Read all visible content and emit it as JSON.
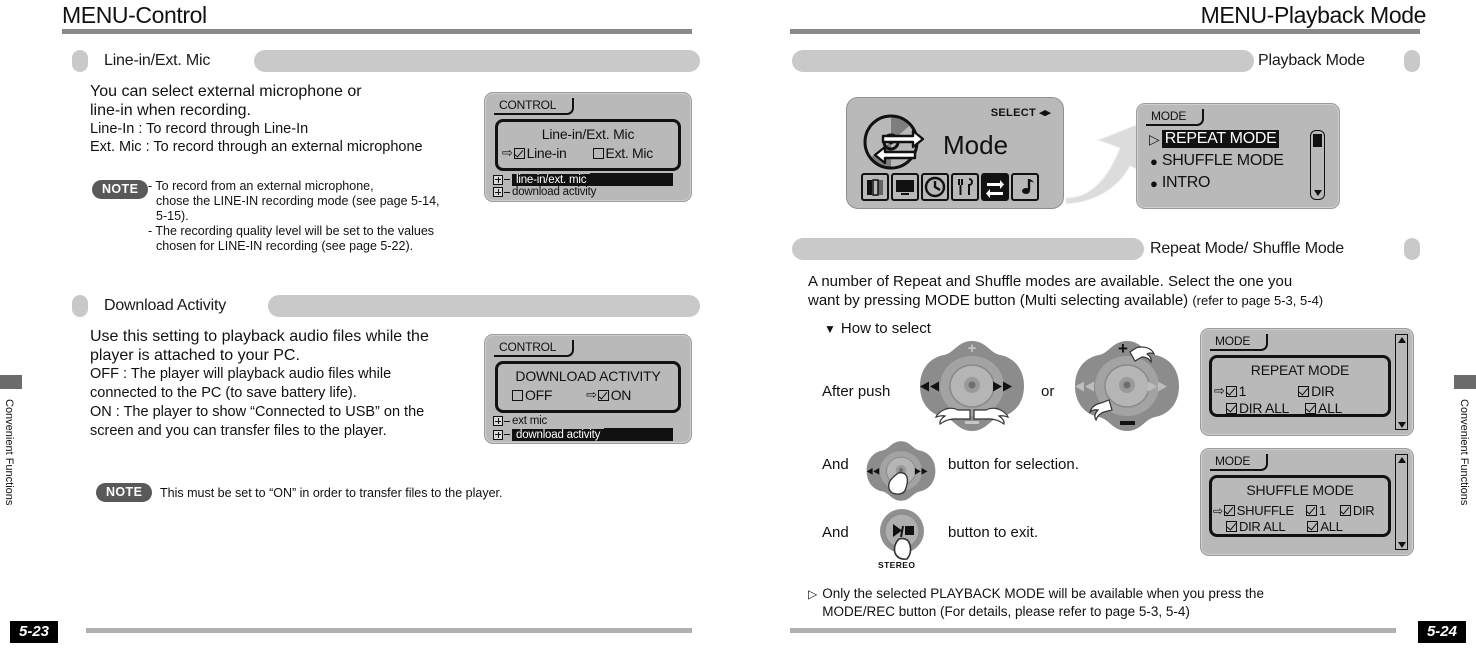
{
  "left_page": {
    "running_head": "MENU-Control",
    "side_tab_label": "Convenient Functions",
    "page_number": "5-23",
    "sections": [
      {
        "title": "Line-in/Ext. Mic",
        "paragraph_lines": [
          "You can select external microphone or",
          "line-in when recording.",
          "Line-In : To record through Line-In",
          "Ext. Mic : To record through an external microphone"
        ],
        "note": {
          "label": "NOTE",
          "lines": [
            "- To record from an external microphone,",
            "chose the LINE-IN recording mode (see page 5-14,",
            "5-15).",
            "- The recording quality level will be set to the values",
            "chosen for LINE-IN recording (see page 5-22)."
          ]
        },
        "lcd": {
          "tab": "CONTROL",
          "window_title": "Line-in/Ext. Mic",
          "options": [
            {
              "label": "Line-in",
              "checked": true,
              "cursor": true
            },
            {
              "label": "Ext. Mic",
              "checked": false,
              "cursor": false
            }
          ],
          "tree": [
            {
              "label": "line-in/ext. mic",
              "selected": true
            },
            {
              "label": "download activity",
              "selected": false
            }
          ]
        }
      },
      {
        "title": "Download Activity",
        "paragraph_lines": [
          "Use this setting to playback audio files while the",
          "player is attached to your PC."
        ],
        "paragraph_lines_small": [
          "OFF : The player will playback audio files while",
          "connected to the PC (to save battery life).",
          "ON : The player to show “Connected to USB” on the",
          "screen and you can transfer files to the player."
        ],
        "note": {
          "label": "NOTE",
          "lines": [
            "This must be set to “ON” in order to transfer files to the player."
          ]
        },
        "lcd": {
          "tab": "CONTROL",
          "window_title": "DOWNLOAD ACTIVITY",
          "options": [
            {
              "label": "OFF",
              "checked": false,
              "cursor": false
            },
            {
              "label": "ON",
              "checked": true,
              "cursor": true
            }
          ],
          "tree": [
            {
              "label": "ext mic",
              "selected": false
            },
            {
              "label": "download activity",
              "selected": true
            }
          ]
        }
      }
    ]
  },
  "right_page": {
    "running_head": "MENU-Playback Mode",
    "side_tab_label": "Convenient Functions",
    "page_number": "5-24",
    "sections": [
      {
        "title": "Playback Mode",
        "mode_screen": {
          "select_label": "SELECT",
          "mode_label": "Mode",
          "icons": [
            "books-icon",
            "monitor-icon",
            "clock-icon",
            "tools-icon",
            "repeat-icon",
            "music-note-icon"
          ],
          "selected_icon_index": 4
        },
        "mode_lcd": {
          "tab": "MODE",
          "items": [
            {
              "label": "REPEAT MODE",
              "selected": true
            },
            {
              "label": "SHUFFLE MODE",
              "selected": false
            },
            {
              "label": "INTRO",
              "selected": false
            }
          ]
        }
      },
      {
        "title": "Repeat Mode/ Shuffle Mode",
        "paragraph_lines": [
          "A number of Repeat and Shuffle modes are available. Select the one you",
          "want by pressing MODE button (Multi selecting available)"
        ],
        "paragraph_tail_small": "(refer to page 5-3, 5-4)",
        "how_to_select": "How to select",
        "steps": [
          {
            "prefix": "After push",
            "middle": "",
            "suffix": "or"
          },
          {
            "prefix": "And",
            "middle": "",
            "suffix": "button for selection."
          },
          {
            "prefix": "And",
            "middle": "",
            "suffix": "button to exit."
          }
        ],
        "stereo_label": "STEREO",
        "repeat_lcd": {
          "tab": "MODE",
          "window_title": "REPEAT MODE",
          "rows": [
            [
              {
                "label": "1",
                "checked": true,
                "cursor": true
              },
              {
                "label": "DIR",
                "checked": true,
                "cursor": false
              }
            ],
            [
              {
                "label": "DIR ALL",
                "checked": true,
                "cursor": false
              },
              {
                "label": "ALL",
                "checked": true,
                "cursor": false
              }
            ]
          ]
        },
        "shuffle_lcd": {
          "tab": "MODE",
          "window_title": "SHUFFLE MODE",
          "rows": [
            [
              {
                "label": "SHUFFLE",
                "checked": true,
                "cursor": true
              },
              {
                "label": "1",
                "checked": true,
                "cursor": false
              },
              {
                "label": "DIR",
                "checked": true,
                "cursor": false
              }
            ],
            [
              {
                "label": "DIR ALL",
                "checked": true,
                "cursor": false
              },
              {
                "label": "ALL",
                "checked": true,
                "cursor": false
              }
            ]
          ]
        },
        "footnote_lines": [
          "Only the selected PLAYBACK MODE will be available when you press the",
          "MODE/REC button (For details, please refer to page 5-3, 5-4)"
        ]
      }
    ]
  },
  "colors": {
    "rule_gray": "#8a8a8a",
    "section_bar_gray": "#c9c9c9",
    "lcd_gray": "#b9b9b9",
    "note_gray": "#595959",
    "footer_rule": "#b0b0b0"
  }
}
